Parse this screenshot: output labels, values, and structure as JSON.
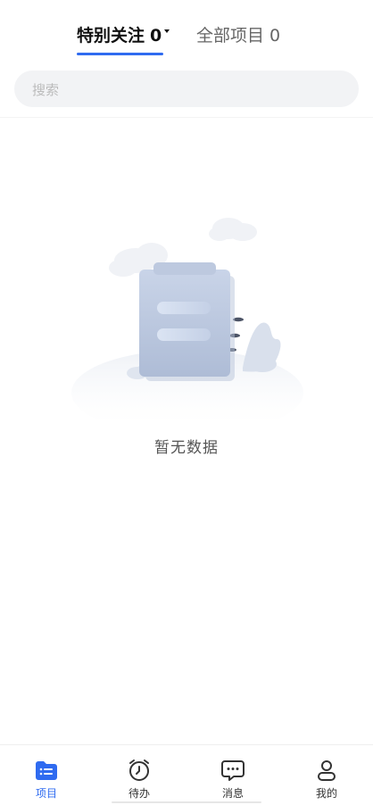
{
  "header": {
    "tabs": [
      {
        "label": "特别关注",
        "count": "0",
        "active": true
      },
      {
        "label": "全部项目",
        "count": "0",
        "active": false
      }
    ]
  },
  "search": {
    "placeholder": "搜索",
    "value": ""
  },
  "empty_state": {
    "text": "暂无数据",
    "illustration": "clipboard-empty-illustration"
  },
  "bottom_nav": {
    "items": [
      {
        "label": "项目",
        "icon": "folder-list-icon",
        "active": true
      },
      {
        "label": "待办",
        "icon": "alarm-clock-icon",
        "active": false
      },
      {
        "label": "消息",
        "icon": "chat-bubble-icon",
        "active": false
      },
      {
        "label": "我的",
        "icon": "person-icon",
        "active": false
      }
    ]
  },
  "colors": {
    "accent": "#2f6bf0",
    "search_bg": "#f2f3f5",
    "text_primary": "#111111",
    "text_secondary": "#666666"
  }
}
